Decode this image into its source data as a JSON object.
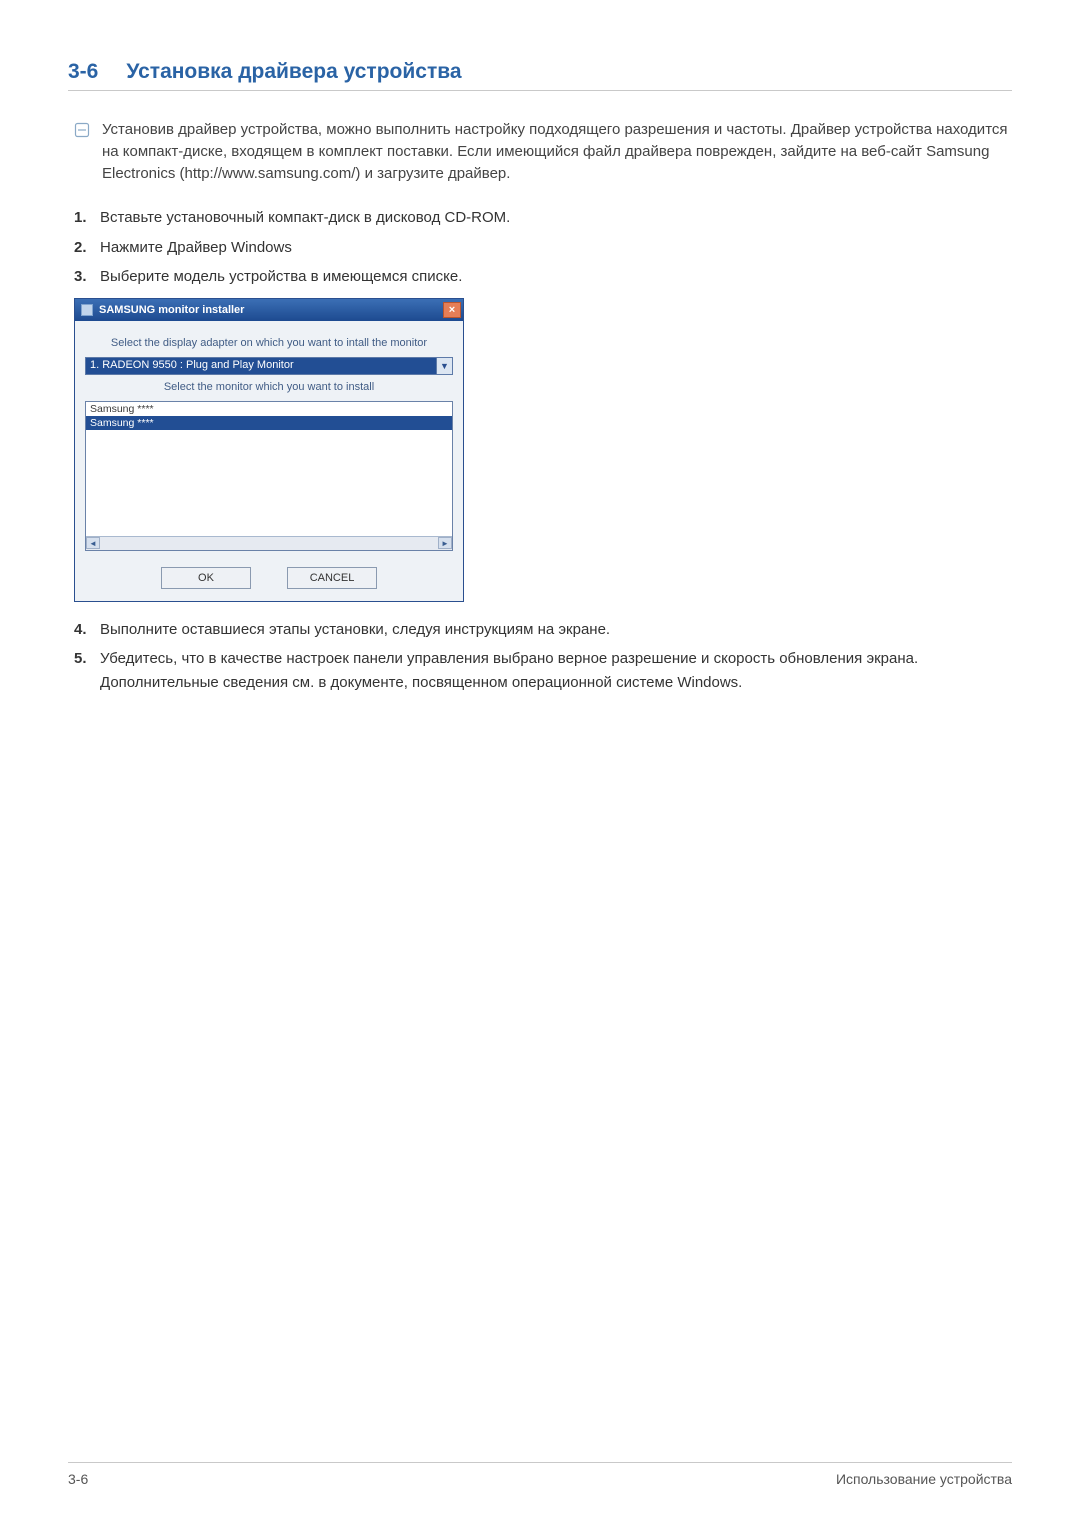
{
  "header": {
    "section_number": "3-6",
    "section_title": "Установка драйвера устройства"
  },
  "note": {
    "text": "Установив драйвер устройства, можно выполнить настройку подходящего разрешения и частоты. Драйвер устройства находится на компакт-диске, входящем в комплект поставки. Если имеющийся файл драйвера поврежден, зайдите на веб-сайт Samsung Electronics (http://www.samsung.com/) и загрузите драйвер."
  },
  "steps": [
    {
      "n": "1.",
      "t": "Вставьте установочный компакт-диск в дисковод CD-ROM."
    },
    {
      "n": "2.",
      "t": "Нажмите Драйвер Windows"
    },
    {
      "n": "3.",
      "t": "Выберите модель устройства в имеющемся списке."
    }
  ],
  "installer": {
    "title": "SAMSUNG monitor installer",
    "label_adapter": "Select the display adapter on which you want to intall the monitor",
    "combo_selected": "1. RADEON 9550 : Plug and Play Monitor",
    "label_monitor": "Select the monitor which you want to install",
    "list": [
      "Samsung ****",
      "Samsung ****"
    ],
    "ok": "OK",
    "cancel": "CANCEL",
    "close": "×"
  },
  "steps2": [
    {
      "n": "4.",
      "t": "Выполните оставшиеся этапы установки, следуя инструкциям на экране."
    },
    {
      "n": "5.",
      "t": "Убедитесь, что в качестве настроек панели управления выбрано верное разрешение и скорость обновления экрана. Дополнительные сведения см. в документе, посвященном операционной системе Windows."
    }
  ],
  "footer": {
    "left": "3-6",
    "right": "Использование устройства"
  }
}
